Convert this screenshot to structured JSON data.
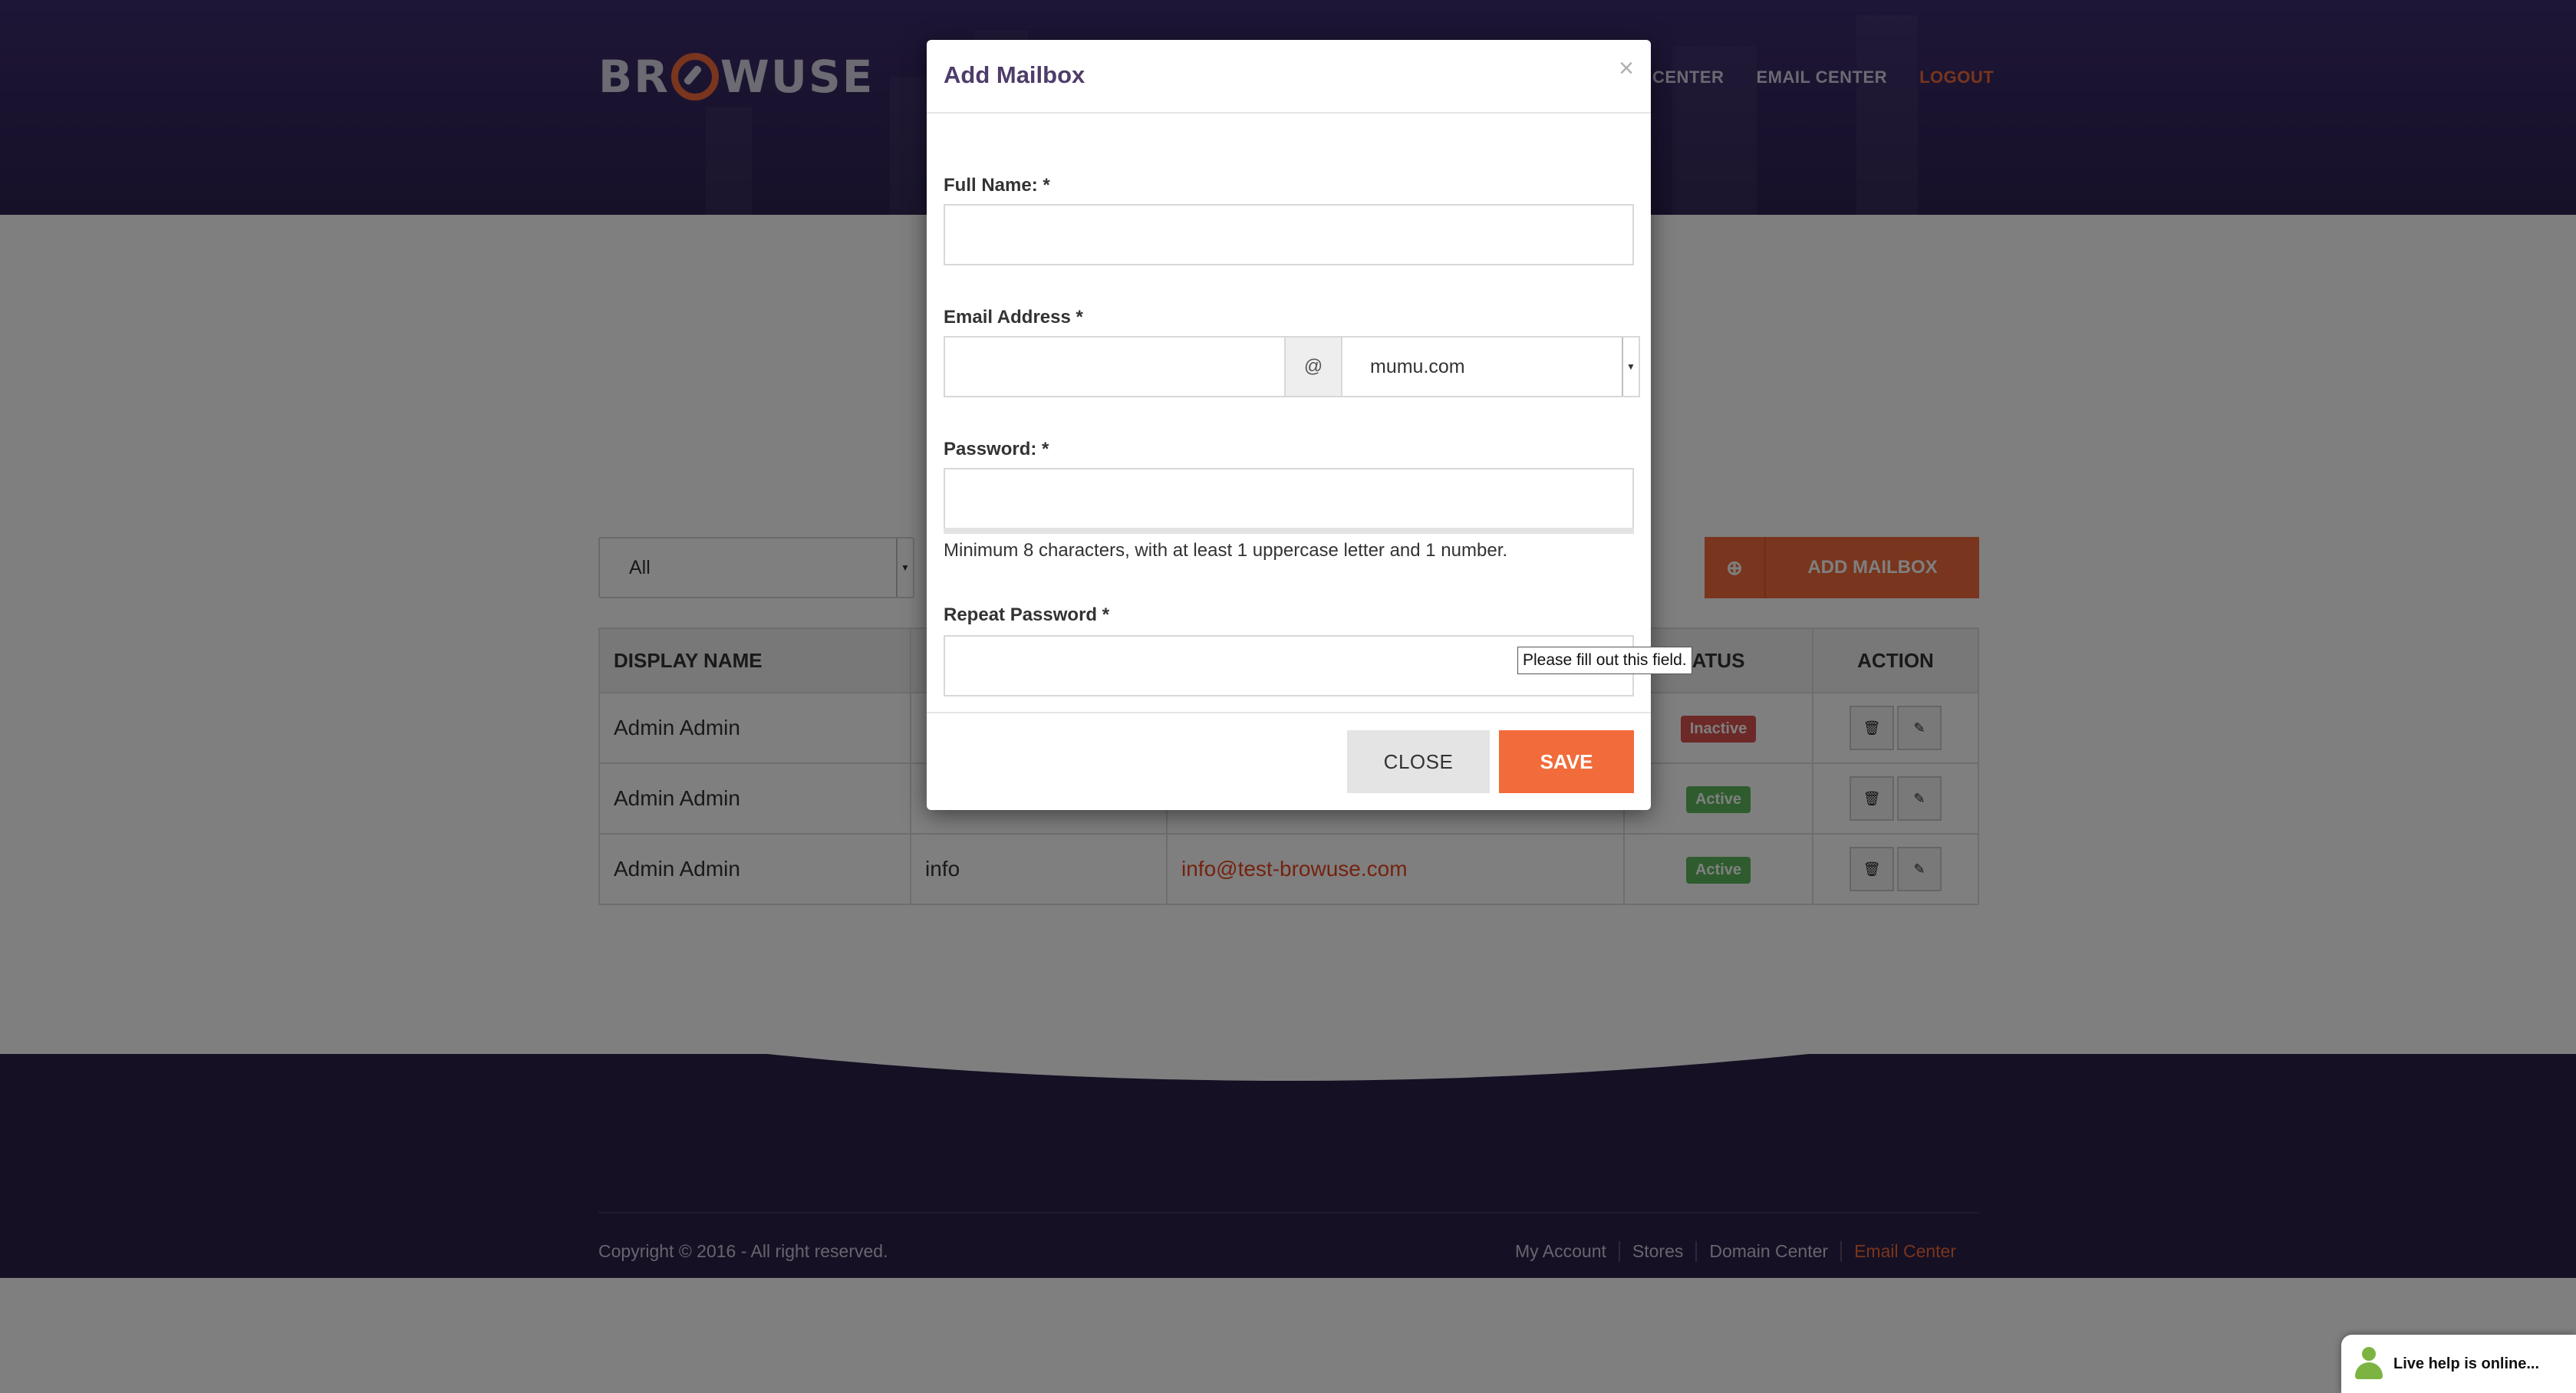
{
  "header": {
    "logo_text_left": "BR",
    "logo_text_right": "WUSE",
    "nav": {
      "domain_center": "CENTER",
      "email_center": "EMAIL CENTER",
      "logout": "LOGOUT"
    }
  },
  "toolbar": {
    "filter_value": "All",
    "add_mailbox_label": "ADD MAILBOX"
  },
  "table": {
    "headers": {
      "display_name": "DISPLAY NAME",
      "status": "ATUS",
      "action": "ACTION"
    },
    "rows": [
      {
        "display_name": "Admin Admin",
        "mailbox": "",
        "email": "",
        "status": "Inactive"
      },
      {
        "display_name": "Admin Admin",
        "mailbox": "",
        "email": "",
        "status": "Active"
      },
      {
        "display_name": "Admin Admin",
        "mailbox": "info",
        "email": "info@test-browuse.com",
        "status": "Active"
      }
    ]
  },
  "footer": {
    "copyright": "Copyright © 2016 - All right reserved.",
    "links": [
      "My Account",
      "Stores",
      "Domain Center",
      "Email Center"
    ]
  },
  "modal": {
    "title": "Add Mailbox",
    "close_symbol": "×",
    "full_name_label": "Full Name: *",
    "email_label": "Email Address *",
    "at_symbol": "@",
    "domain_value": "mumu.com",
    "password_label": "Password: *",
    "password_help": "Minimum 8 characters, with at least 1 uppercase letter and 1 number.",
    "repeat_password_label": "Repeat Password *",
    "close_button": "CLOSE",
    "save_button": "SAVE"
  },
  "tooltip": "Please fill out this field.",
  "live_help": "Live help is online...",
  "colors": {
    "accent": "#f26b3a",
    "header_bg": "#3c2c6c",
    "inactive": "#d9534f",
    "active": "#5cb85c"
  }
}
